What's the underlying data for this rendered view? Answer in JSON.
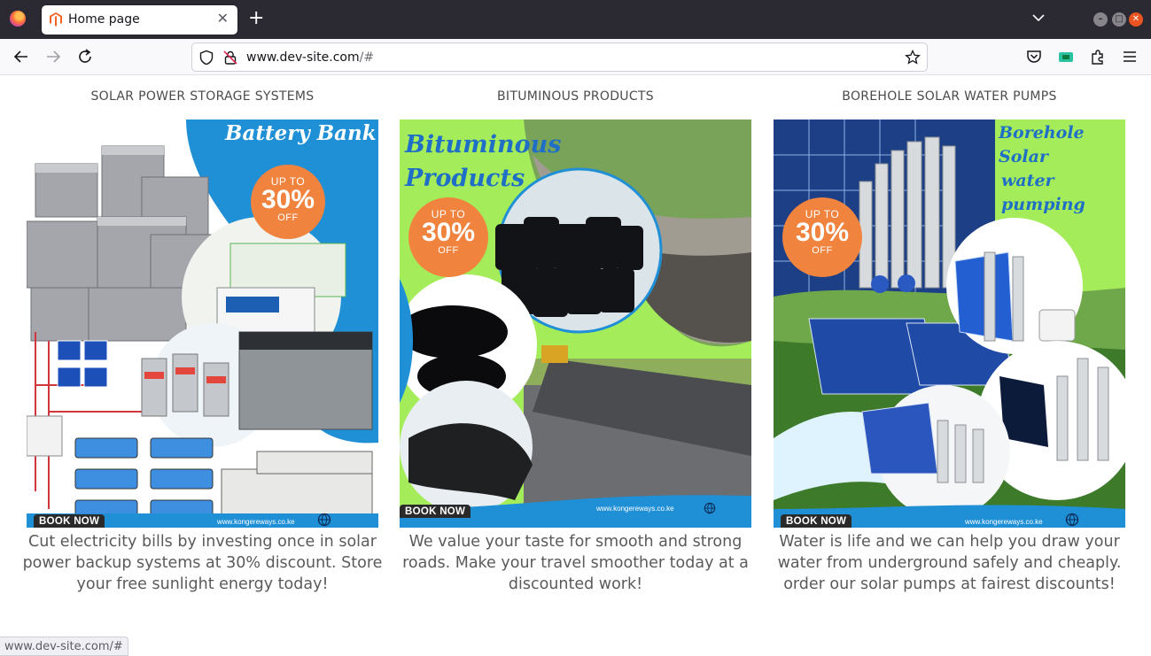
{
  "browser": {
    "tab_title": "Home page",
    "url_host": "www.dev-site.com",
    "url_path": "/#",
    "status_url": "www.dev-site.com/#"
  },
  "cards": [
    {
      "title": "SOLAR POWER STORAGE SYSTEMS",
      "banner": "Battery Bank",
      "badge_top": "UP TO",
      "badge_value": "30%",
      "badge_bottom": "OFF",
      "book": "BOOK NOW",
      "site": "www.kongereways.co.ke",
      "description": "Cut electricity bills by investing once in solar power backup systems at 30% discount. Store your free sunlight energy today!"
    },
    {
      "title": "BITUMINOUS PRODUCTS",
      "banner_line1": "Bituminous",
      "banner_line2": "Products",
      "badge_top": "UP TO",
      "badge_value": "30%",
      "badge_bottom": "OFF",
      "book": "BOOK NOW",
      "site": "www.kongereways.co.ke",
      "description": "We value your taste for smooth and strong roads. Make your travel smoother today at a discounted work!"
    },
    {
      "title": "BOREHOLE SOLAR WATER PUMPS",
      "banner_line1": "Borehole Solar",
      "banner_line2": "water pumping",
      "badge_top": "UP TO",
      "badge_value": "30%",
      "badge_bottom": "OFF",
      "book": "BOOK NOW",
      "site": "www.kongereways.co.ke",
      "description": "Water is life and we can help you draw your water from underground safely and cheaply. order our solar pumps at fairest discounts!"
    }
  ],
  "colors": {
    "accent_orange": "#f0843f",
    "banner_blue": "#1f8fd6",
    "banner_green": "#a5ec5a",
    "text_gray": "#5a5a5a"
  }
}
